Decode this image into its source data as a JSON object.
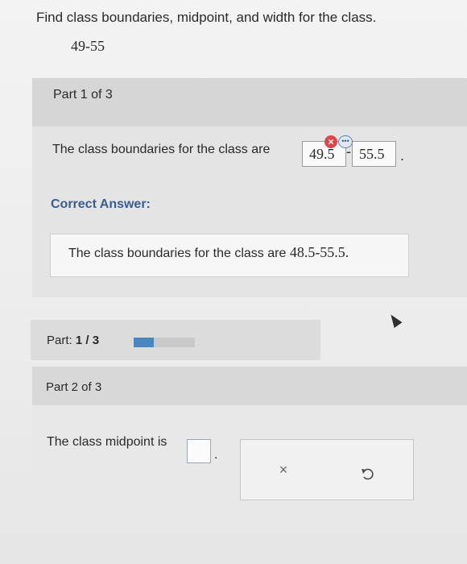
{
  "question": {
    "prompt": "Find class boundaries, midpoint, and width for the class.",
    "class_interval": "49-55"
  },
  "part1": {
    "header": "Part 1 of 3",
    "statement": "The class boundaries for the class are",
    "answer_lower": "49.5",
    "separator": "-",
    "answer_upper": "55.5",
    "terminator": ".",
    "wrong_mark": "×",
    "more_mark": "•••",
    "correct_answer_label": "Correct Answer:",
    "correct_answer_text": "The class boundaries for the class are",
    "correct_answer_value": "48.5-55.5."
  },
  "progress": {
    "label_prefix": "Part:",
    "current": "1 / 3",
    "fraction": 0.33
  },
  "part2": {
    "header": "Part 2 of 3",
    "statement": "The class midpoint is",
    "terminator": ".",
    "clear_symbol": "×"
  },
  "icons": {
    "wrong": "x-circle-icon",
    "more": "more-options-icon",
    "clear": "clear-icon",
    "undo": "undo-icon",
    "cursor": "mouse-pointer-icon"
  },
  "colors": {
    "accent": "#4a86c2",
    "correct_label": "#3a5d8f",
    "wrong": "#d84a4a"
  }
}
